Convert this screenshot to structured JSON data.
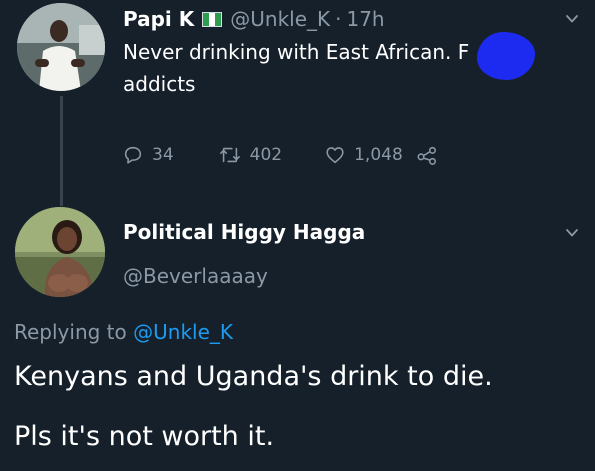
{
  "tweet1": {
    "display_name": "Papi K",
    "flag_icon": "nigeria-flag-icon",
    "handle": "@Unkle_K",
    "separator": "·",
    "timestamp": "17h",
    "text_line1": "Never drinking with East African. F",
    "text_line2": "addicts",
    "redaction_color": "#1d2bf0",
    "stats": {
      "replies": "34",
      "retweets": "402",
      "likes": "1,048"
    }
  },
  "tweet2": {
    "display_name": "Political Higgy Hagga",
    "handle": "@Beverlaaaay",
    "replying_prefix": "Replying to",
    "replying_handle": "@Unkle_K",
    "body_line1": "Kenyans and Uganda's drink to die.",
    "body_line2": "Pls it's not worth it."
  },
  "colors": {
    "background": "#15202b",
    "primary_text": "#ffffff",
    "secondary_text": "#8b98a5",
    "link": "#1d9bf0",
    "thread_line": "#38444d"
  }
}
